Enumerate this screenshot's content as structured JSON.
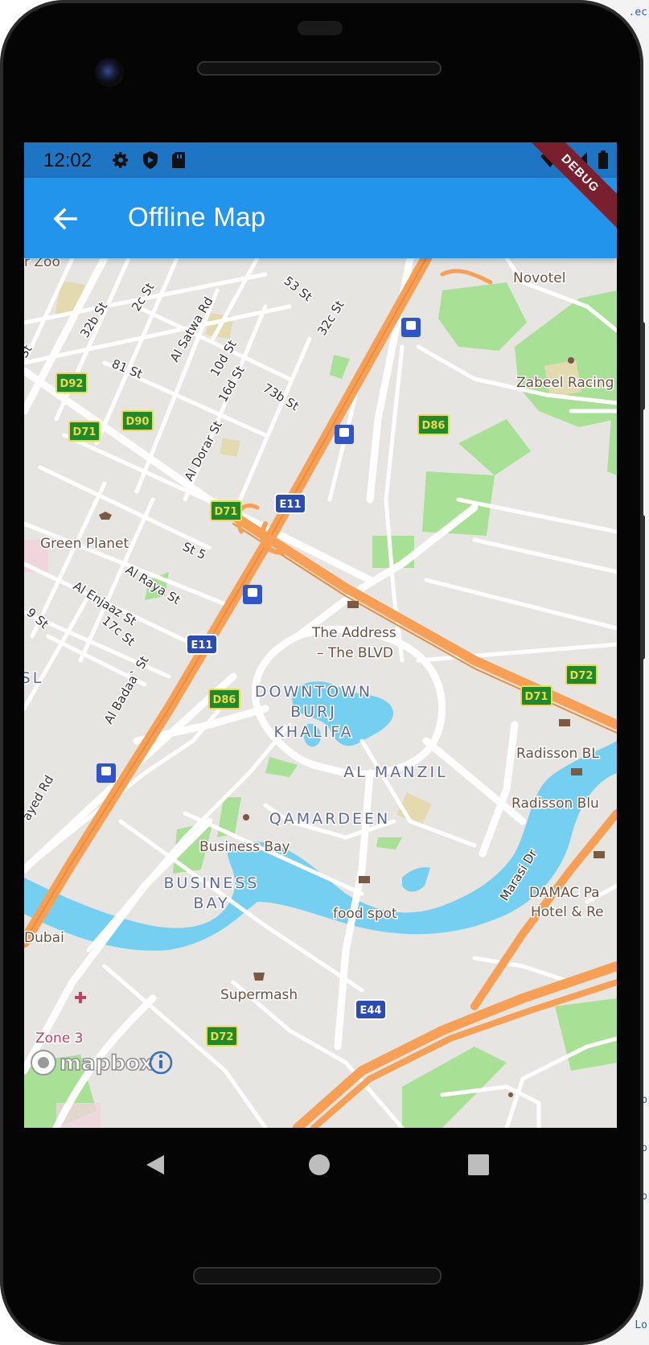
{
  "background": {
    "links": [
      ".ec",
      "p",
      "p",
      "p",
      "Lo"
    ]
  },
  "status_bar": {
    "time": "12:02",
    "left_icons": [
      "gear-icon",
      "shield-icon",
      "sd-card-icon"
    ],
    "right_icons": [
      "wifi-icon",
      "signal-icon",
      "battery-icon"
    ]
  },
  "app_bar": {
    "title": "Offline Map",
    "back_icon": "arrow-left-icon",
    "debug_banner": "DEBUG"
  },
  "map": {
    "places": {
      "novotel": "Novotel",
      "zabeel": "Zabeel Racing S",
      "green_planet": "Green Planet",
      "address_1": "The Address",
      "address_2": "– The BLVD",
      "downtown_1": "DOWNTOWN",
      "downtown_2": "BURJ",
      "downtown_3": "KHALIFA",
      "al_manzil": "AL MANZIL",
      "qamardeen": "QAMARDEEN",
      "business_bay_poi": "Business Bay",
      "business_bay_1": "BUSINESS",
      "business_bay_2": "BAY",
      "radisson_1": "Radisson BL",
      "radisson_2": "Radisson Blu",
      "damac_1": "DAMAC Pa",
      "damac_2": "Hotel & Re",
      "food_spot": "food spot",
      "supermash": "Supermash",
      "zone3": "Zone 3",
      "dubai": "Dubai",
      "zoo": "r Zoo",
      "sl": "SL"
    },
    "streets": {
      "s53": "53 St",
      "s32c": "32c St",
      "s2c": "2c St",
      "s32b": "32b St",
      "satwa": "Al Satwa Rd",
      "s10d": "10d St",
      "s16d": "16d St",
      "s81": "81 St",
      "s73b": "73b St",
      "dorar": "Al Dorar St",
      "st5": "St 5",
      "raya": "Al Raya St",
      "enjaaz": "Al Enjaaz St",
      "s17c": "17c St",
      "s9": "9 St",
      "badaa": "Al Badaa` St",
      "zayed": "ayed Rd",
      "marasi": "Marasi Dr",
      "st_left": "St"
    },
    "shields": {
      "d92": "D92",
      "d90": "D90",
      "d71a": "D71",
      "d71b": "D71",
      "d71c": "D71",
      "d86a": "D86",
      "d86b": "D86",
      "d72a": "D72",
      "d72b": "D72",
      "e11a": "E11",
      "e11b": "E11",
      "e44": "E44"
    },
    "attribution": "mapbox",
    "colors": {
      "land": "#e7e5e1",
      "water": "#75cff0",
      "park": "#a8e095",
      "highway": "#f7a055",
      "road": "#ffffff",
      "shield_green": "#1e8a2e",
      "shield_blue": "#2b4bb5"
    }
  },
  "nav_bar": {
    "back": "triangle-back-icon",
    "home": "circle-home-icon",
    "recents": "square-recents-icon"
  }
}
